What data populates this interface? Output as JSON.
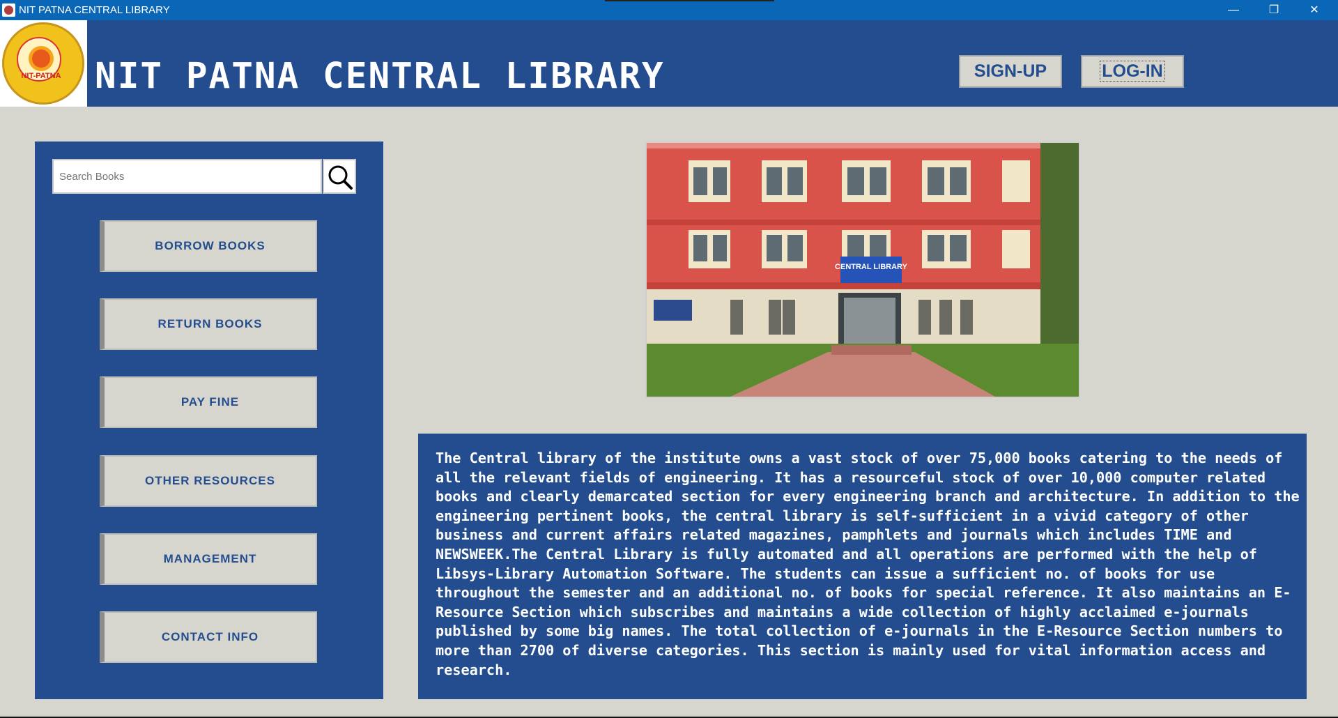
{
  "window": {
    "title": "NIT PATNA CENTRAL LIBRARY",
    "controls": {
      "minimize": "—",
      "maximize": "❐",
      "close": "✕"
    }
  },
  "header": {
    "logo_text": "NIT-PATNA",
    "brand_title": "NIT PATNA CENTRAL LIBRARY",
    "signup_label": "SIGN-UP",
    "login_label": "LOG-IN"
  },
  "sidebar": {
    "search_placeholder": "Search Books",
    "search_icon": "magnifier-icon",
    "buttons": [
      {
        "label": "BORROW BOOKS"
      },
      {
        "label": "RETURN BOOKS"
      },
      {
        "label": "PAY FINE"
      },
      {
        "label": "OTHER RESOURCES"
      },
      {
        "label": "MANAGEMENT"
      },
      {
        "label": "CONTACT INFO"
      }
    ]
  },
  "photo": {
    "sign_text": "CENTRAL LIBRARY"
  },
  "description": {
    "text": "The Central library of the institute owns a vast stock of over 75,000 books catering to the needs of all the relevant fields of engineering. It has a resourceful stock of over 10,000 computer related books and clearly demarcated section for every engineering branch and architecture. In addition to the engineering pertinent books, the central library is self-sufficient in a vivid category of other business and current affairs related magazines, pamphlets and journals which includes TIME and NEWSWEEK.The Central Library is fully automated and all operations are performed with the help of Libsys-Library Automation Software. The students can issue a sufficient no. of books for use throughout the semester and an additional no. of books for special reference. It also maintains an E-Resource Section which subscribes and maintains a wide collection of highly acclaimed e-journals published by some big names. The total collection of e-journals in the E-Resource Section numbers to more than 2700 of diverse categories. This section is mainly used for vital information access and research."
  },
  "colors": {
    "title_bar": "#0a67b7",
    "panel_blue": "#234d8e",
    "background": "#d6d6cf",
    "button_text": "#234d8e"
  }
}
